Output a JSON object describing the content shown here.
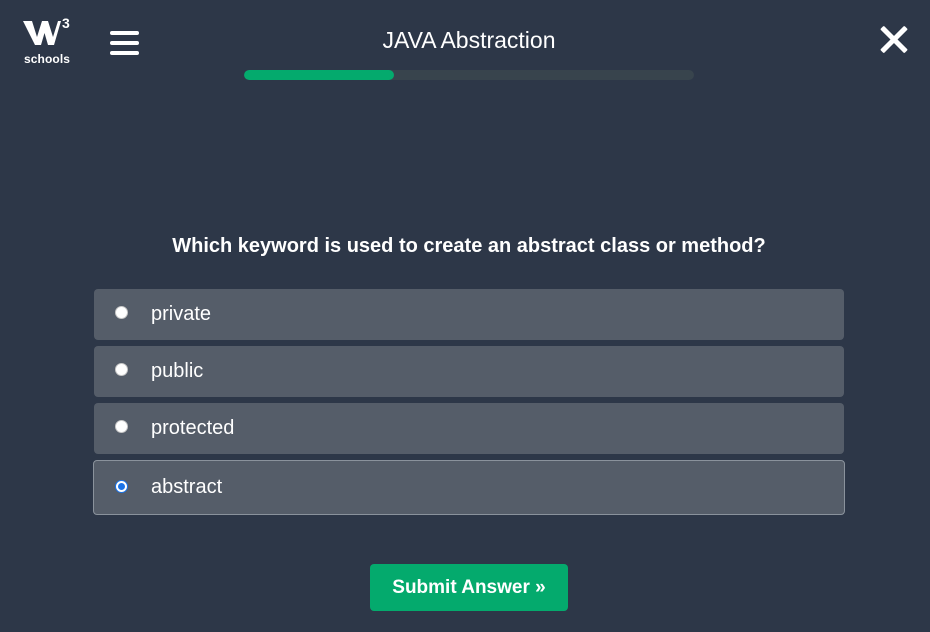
{
  "logo": {
    "superscript": "3",
    "wordmark": "schools",
    "icon": "w3schools-logo-icon"
  },
  "header": {
    "menu_icon": "hamburger-menu-icon",
    "title": "JAVA Abstraction",
    "progress_fraction": 0.333,
    "close_icon": "close-icon"
  },
  "quiz": {
    "question": "Which keyword is used to create an abstract class or method?",
    "options": [
      {
        "label": "private",
        "selected": false
      },
      {
        "label": "public",
        "selected": false
      },
      {
        "label": "protected",
        "selected": false
      },
      {
        "label": "abstract",
        "selected": true
      }
    ],
    "submit_label": "Submit Answer »"
  },
  "colors": {
    "background": "#2d3748",
    "option_background": "#555d69",
    "accent_green": "#04aa6d",
    "progress_track": "#38444d",
    "radio_selected": "#1a73e8"
  }
}
